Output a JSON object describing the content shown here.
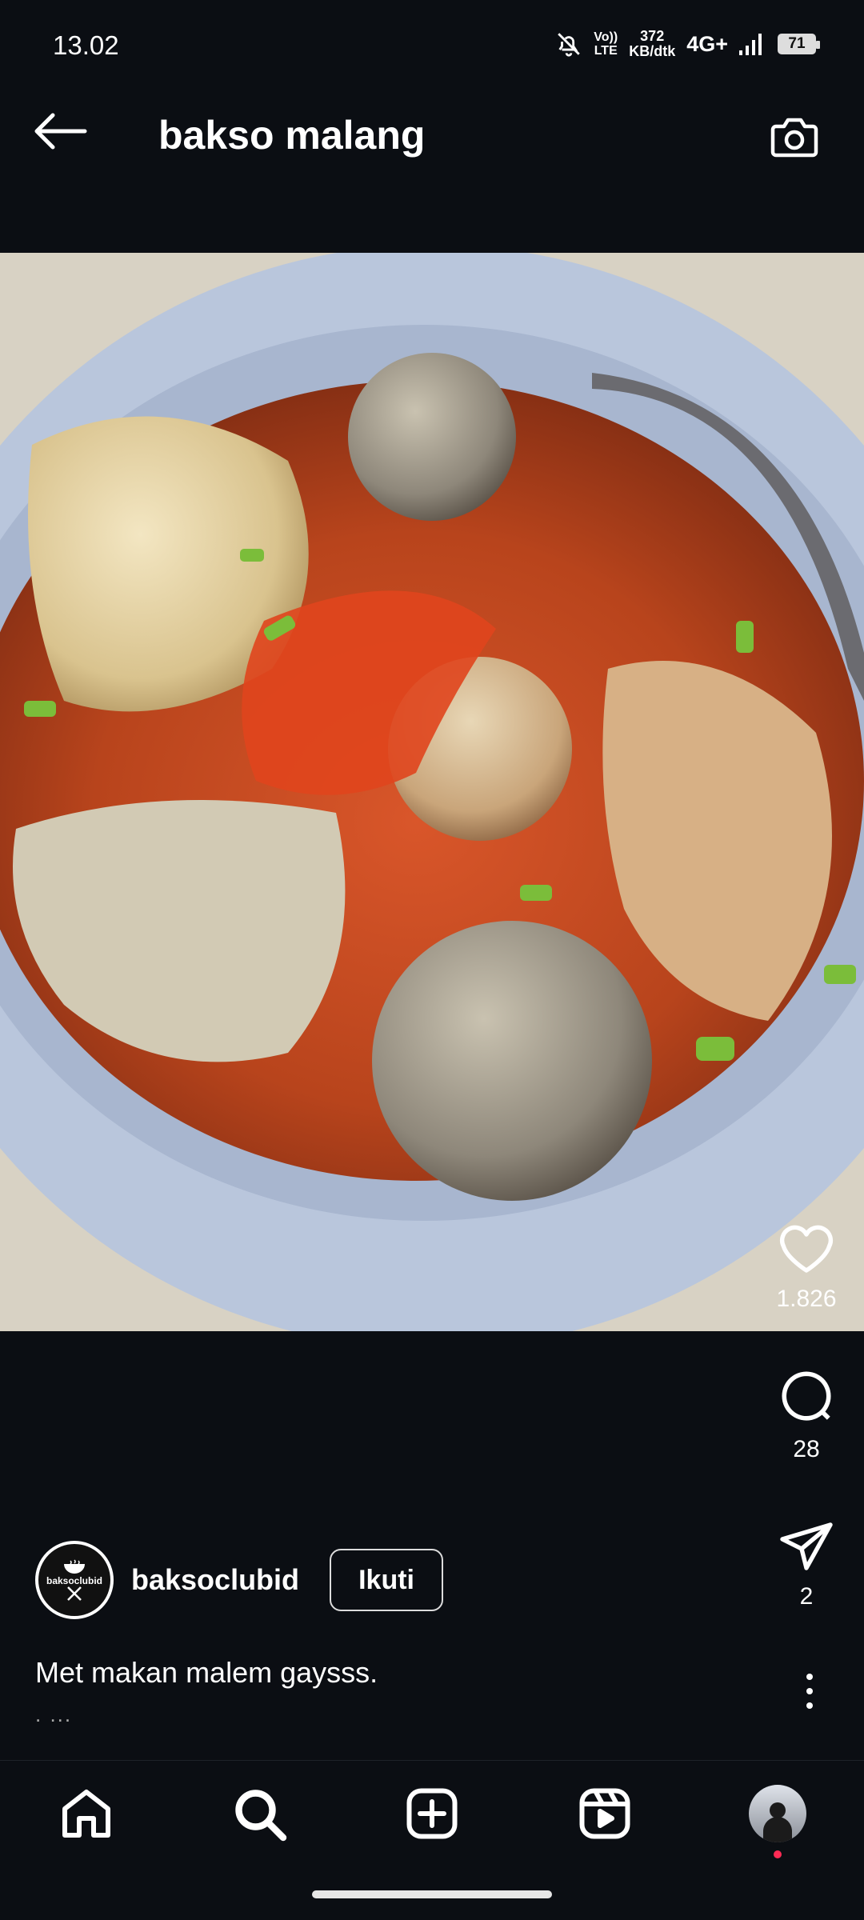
{
  "status_bar": {
    "time": "13.02",
    "network_speed_top": "372",
    "network_speed_bottom": "KB/dtk",
    "volte_top": "Vo))",
    "volte_bottom": "LTE",
    "network_type": "4G+",
    "battery": "71"
  },
  "header": {
    "title": "bakso malang",
    "back_icon": "arrow-left-icon",
    "camera_icon": "camera-icon"
  },
  "post": {
    "image_icon": "food-photo",
    "likes": "1.826",
    "comments": "28",
    "shares": "2",
    "author": {
      "username": "baksoclubid",
      "avatar_text": "baksoclubid"
    },
    "follow_label": "Ikuti",
    "caption": "Met makan malem gaysss.",
    "caption_more": ". ..."
  },
  "bottom_nav": {
    "items": [
      {
        "name": "home",
        "icon": "home-icon"
      },
      {
        "name": "search",
        "icon": "search-icon"
      },
      {
        "name": "create",
        "icon": "plus-square-icon"
      },
      {
        "name": "reels",
        "icon": "reels-icon"
      },
      {
        "name": "profile",
        "icon": "profile-avatar"
      }
    ]
  },
  "colors": {
    "background": "#0b0e13",
    "text": "#ffffff",
    "notification_dot": "#ff2b55"
  }
}
